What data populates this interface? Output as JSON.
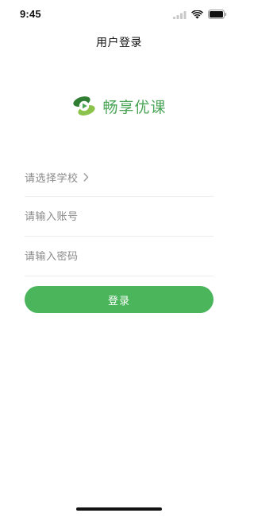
{
  "status_bar": {
    "time": "9:45",
    "signal_icon": "cellular-signal-icon",
    "wifi_icon": "wifi-icon",
    "battery_icon": "battery-icon"
  },
  "header": {
    "title": "用户登录"
  },
  "logo": {
    "icon": "play-logo-icon",
    "text": "畅享优课",
    "color": "#4aa456"
  },
  "form": {
    "school_select": {
      "label": "请选择学校",
      "icon": "chevron-right-icon"
    },
    "account": {
      "value": "",
      "placeholder": "请输入账号"
    },
    "password": {
      "value": "",
      "placeholder": "请输入密码"
    }
  },
  "login_button": {
    "label": "登录",
    "color": "#4bb55c"
  }
}
